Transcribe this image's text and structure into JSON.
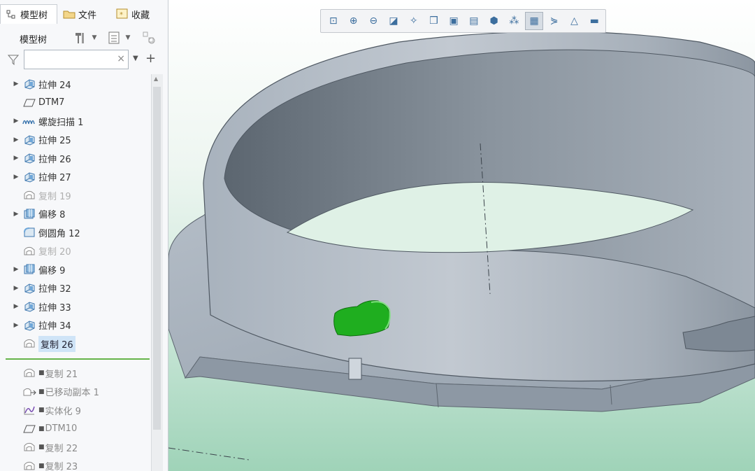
{
  "tabs": [
    {
      "label": "模型树",
      "icon": "model-tree-icon"
    },
    {
      "label": "文件",
      "icon": "folder-icon"
    },
    {
      "label": "收藏",
      "icon": "favorites-icon"
    }
  ],
  "toolbar": {
    "title": "模型树"
  },
  "search": {
    "value": "",
    "placeholder": ""
  },
  "tree": [
    {
      "label": "拉伸 24",
      "icon": "extrude-icon",
      "expandable": true,
      "state": "normal"
    },
    {
      "label": "DTM7",
      "icon": "datum-plane-icon",
      "expandable": false,
      "state": "normal"
    },
    {
      "label": "螺旋扫描 1",
      "icon": "helical-sweep-icon",
      "expandable": true,
      "state": "normal"
    },
    {
      "label": "拉伸 25",
      "icon": "extrude-icon",
      "expandable": true,
      "state": "normal"
    },
    {
      "label": "拉伸 26",
      "icon": "extrude-icon",
      "expandable": true,
      "state": "normal"
    },
    {
      "label": "拉伸 27",
      "icon": "extrude-icon",
      "expandable": true,
      "state": "normal"
    },
    {
      "label": "复制 19",
      "icon": "copy-icon",
      "expandable": false,
      "state": "dim"
    },
    {
      "label": "偏移 8",
      "icon": "offset-icon",
      "expandable": true,
      "state": "normal"
    },
    {
      "label": "倒圆角 12",
      "icon": "round-icon",
      "expandable": false,
      "state": "normal"
    },
    {
      "label": "复制 20",
      "icon": "copy-icon",
      "expandable": false,
      "state": "dim"
    },
    {
      "label": "偏移 9",
      "icon": "offset-icon",
      "expandable": true,
      "state": "normal"
    },
    {
      "label": "拉伸 32",
      "icon": "extrude-icon",
      "expandable": true,
      "state": "normal"
    },
    {
      "label": "拉伸 33",
      "icon": "extrude-icon",
      "expandable": true,
      "state": "normal"
    },
    {
      "label": "拉伸 34",
      "icon": "extrude-icon",
      "expandable": true,
      "state": "normal"
    },
    {
      "label": "复制 26",
      "icon": "copy-icon",
      "expandable": false,
      "state": "selected"
    }
  ],
  "inserted": [
    {
      "label": "复制 21",
      "icon": "copy-icon"
    },
    {
      "label": "已移动副本 1",
      "icon": "moved-copy-icon"
    },
    {
      "label": "实体化 9",
      "icon": "solidify-icon"
    },
    {
      "label": "DTM10",
      "icon": "datum-plane-icon"
    },
    {
      "label": "复制 22",
      "icon": "copy-icon"
    },
    {
      "label": "复制 23",
      "icon": "copy-icon"
    }
  ],
  "view_toolbar": [
    {
      "name": "refit-icon",
      "glyph": "⊡"
    },
    {
      "name": "zoom-in-icon",
      "glyph": "⊕"
    },
    {
      "name": "zoom-out-icon",
      "glyph": "⊖"
    },
    {
      "name": "repaint-icon",
      "glyph": "◪"
    },
    {
      "name": "spin-center-icon",
      "glyph": "✧"
    },
    {
      "name": "display-style-icon",
      "glyph": "❒"
    },
    {
      "name": "saved-views-icon",
      "glyph": "▣"
    },
    {
      "name": "view-manager-icon",
      "glyph": "▤"
    },
    {
      "name": "perspective-icon",
      "glyph": "⬢"
    },
    {
      "name": "datum-display-icon",
      "glyph": "⁂"
    },
    {
      "name": "annotation-display-icon",
      "glyph": "▦",
      "active": true
    },
    {
      "name": "spin-tool-icon",
      "glyph": "⋟"
    },
    {
      "name": "appearance-icon",
      "glyph": "△"
    },
    {
      "name": "named-view-icon",
      "glyph": "▬"
    }
  ],
  "colors": {
    "selection": "#1fae1f",
    "model": "#9aa6b3",
    "divider": "#66b44a"
  }
}
